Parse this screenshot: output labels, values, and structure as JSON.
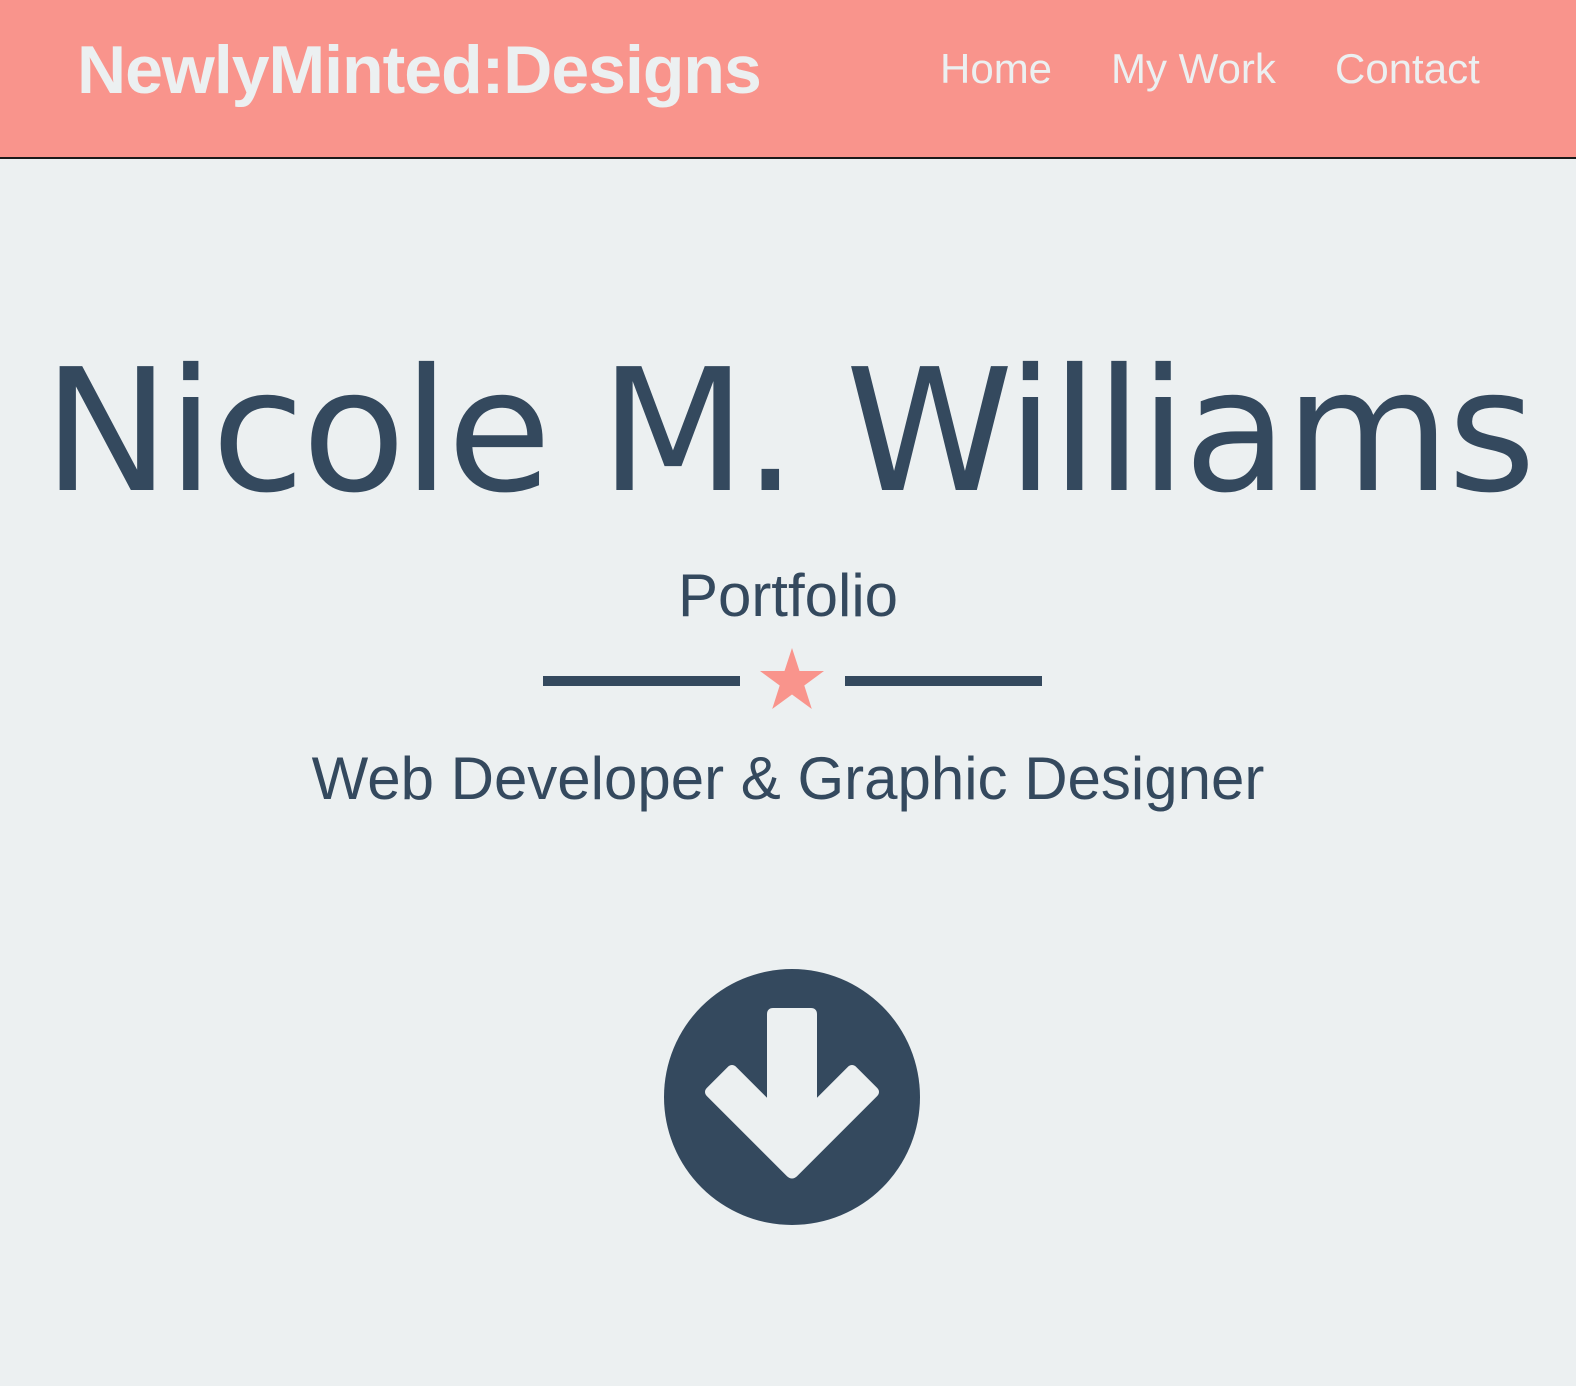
{
  "header": {
    "brand": "NewlyMinted:Designs",
    "nav": [
      {
        "label": "Home"
      },
      {
        "label": "My Work"
      },
      {
        "label": "Contact"
      }
    ]
  },
  "hero": {
    "name": "Nicole M. Williams",
    "subtitle": "Portfolio",
    "tagline": "Web Developer & Graphic Designer"
  },
  "icons": {
    "divider": "star-icon",
    "scroll": "arrow-circle-down-icon"
  },
  "colors": {
    "header_bg": "#f9948c",
    "page_bg": "#ecf0f1",
    "text_dark": "#34495e",
    "text_light": "#ecf0f1",
    "accent": "#f9948c"
  }
}
